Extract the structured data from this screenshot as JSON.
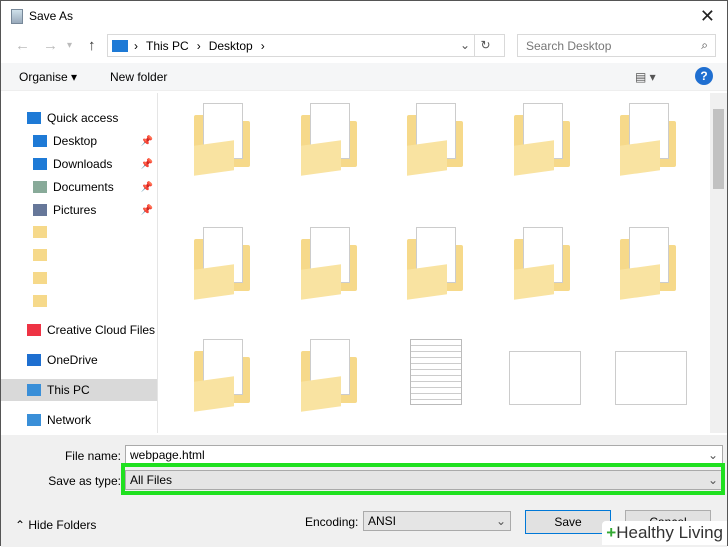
{
  "window": {
    "title": "Save As",
    "close": "✕"
  },
  "nav": {
    "back": "←",
    "forward": "→",
    "recent": "▾",
    "up": "↑",
    "path": [
      "This PC",
      "Desktop"
    ],
    "sep": "›",
    "dropdown": "⌄",
    "refresh": "↻",
    "search_placeholder": "Search Desktop",
    "search_icon": "⌕"
  },
  "toolbar": {
    "organise": "Organise ▾",
    "new_folder": "New folder",
    "view": "▤ ▾",
    "help": "?"
  },
  "sidebar": {
    "items": [
      {
        "label": "Quick access",
        "icon": "star-icon",
        "color": "#1e7ad6"
      },
      {
        "label": "Desktop",
        "icon": "desktop-icon",
        "color": "#1e7ad6",
        "pin": "📌"
      },
      {
        "label": "Downloads",
        "icon": "download-icon",
        "color": "#1e7ad6",
        "pin": "📌"
      },
      {
        "label": "Documents",
        "icon": "documents-icon",
        "color": "#8a9",
        "pin": "📌"
      },
      {
        "label": "Pictures",
        "icon": "pictures-icon",
        "color": "#679",
        "pin": "📌"
      },
      {
        "label": "",
        "icon": "folder-icon",
        "color": "#f6d98a"
      },
      {
        "label": "",
        "icon": "folder-icon",
        "color": "#f6d98a"
      },
      {
        "label": "",
        "icon": "folder-icon",
        "color": "#f6d98a"
      },
      {
        "label": "",
        "icon": "folder-icon",
        "color": "#f6d98a"
      },
      {
        "label": "Creative Cloud Files",
        "icon": "creative-cloud-icon",
        "color": "#e34"
      },
      {
        "label": "OneDrive",
        "icon": "onedrive-icon",
        "color": "#1e6fd0"
      },
      {
        "label": "This PC",
        "icon": "pc-icon",
        "color": "#3a8fd8",
        "selected": true
      },
      {
        "label": "Network",
        "icon": "network-icon",
        "color": "#3a8fd8"
      }
    ]
  },
  "files": [
    {
      "kind": "folder"
    },
    {
      "kind": "folder"
    },
    {
      "kind": "folder"
    },
    {
      "kind": "folder"
    },
    {
      "kind": "folder"
    },
    {
      "kind": "folder"
    },
    {
      "kind": "folder"
    },
    {
      "kind": "folder"
    },
    {
      "kind": "folder"
    },
    {
      "kind": "folder"
    },
    {
      "kind": "folder"
    },
    {
      "kind": "folder"
    },
    {
      "kind": "document"
    },
    {
      "kind": "image"
    },
    {
      "kind": "image"
    }
  ],
  "form": {
    "file_name_label": "File name:",
    "file_name": "webpage.html",
    "type_label": "Save as type:",
    "type": "All Files",
    "encoding_label": "Encoding:",
    "encoding": "ANSI",
    "save": "Save",
    "cancel": "Cancel",
    "hide_folders": "⌃ Hide Folders",
    "highlight_color": "#1fe01f"
  },
  "watermark": {
    "plus": "+",
    "text": "Healthy Living"
  }
}
